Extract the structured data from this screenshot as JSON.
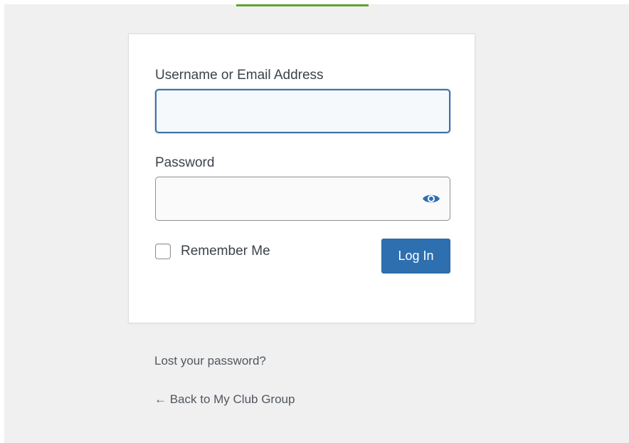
{
  "colors": {
    "page_background": "#f0f0f1",
    "accent_bar": "#5aa436",
    "focus_border": "#3f72a8",
    "primary_button": "#2e6fb0",
    "eye_icon": "#2e6fb0"
  },
  "login_form": {
    "username_label": "Username or Email Address",
    "username_value": "",
    "password_label": "Password",
    "password_value": "",
    "show_password_icon": "eye-icon",
    "remember_label": "Remember Me",
    "remember_checked": false,
    "submit_label": "Log In"
  },
  "nav": {
    "lost_password": "Lost your password?",
    "back_to_site": "← Back to My Club Group"
  }
}
